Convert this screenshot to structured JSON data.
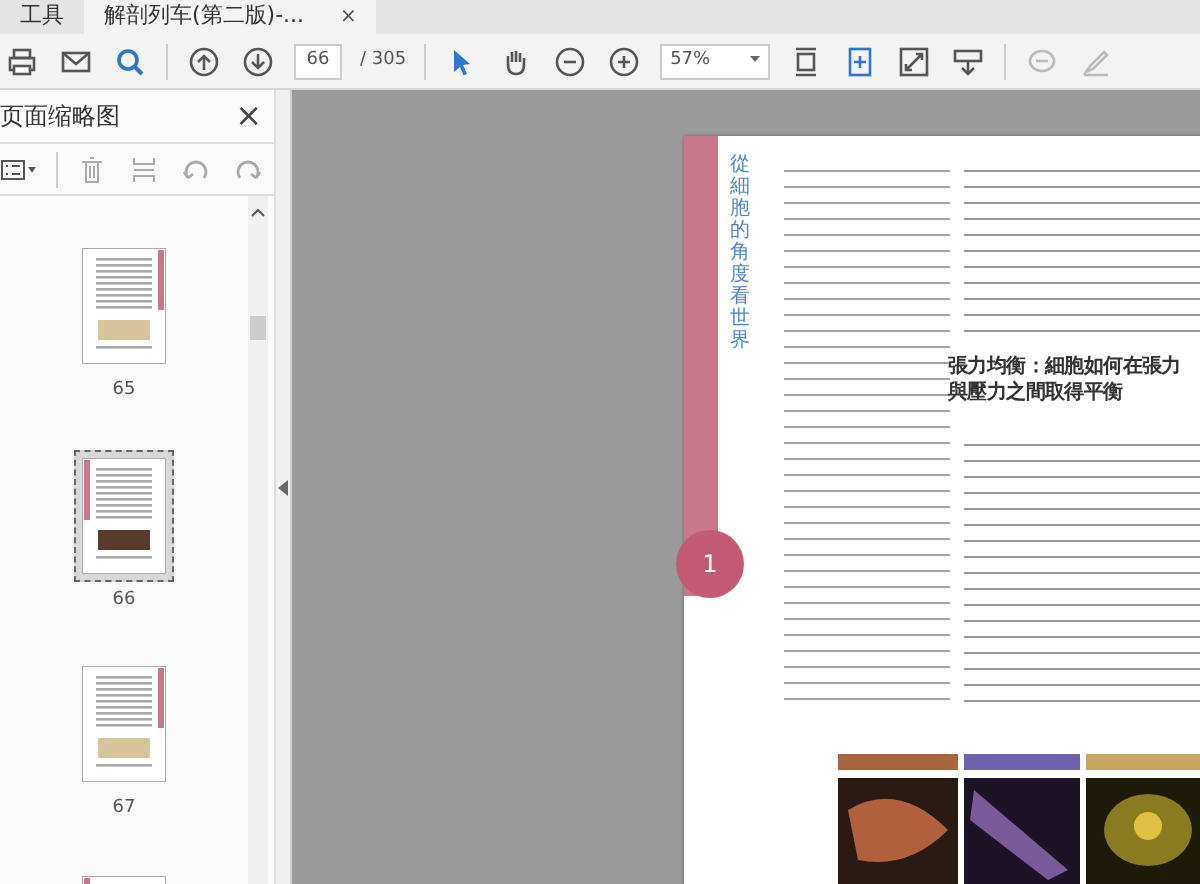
{
  "tabs": [
    {
      "label": "工具",
      "selected": false
    },
    {
      "label": "解剖列车(第二版)-...",
      "selected": true,
      "close": "×"
    }
  ],
  "toolbar": {
    "page_current": "66",
    "page_total": "/ 305",
    "zoom": "57%"
  },
  "panel": {
    "title": "页面缩略图",
    "close": "×",
    "thumbnails": [
      {
        "label": "65",
        "selected": false
      },
      {
        "label": "66",
        "selected": true
      },
      {
        "label": "67",
        "selected": false
      },
      {
        "selected": false
      }
    ]
  },
  "document": {
    "side_title": "從細胞的角度看世界",
    "chapter": "1",
    "heading_lines": [
      "張力均衡：細胞如何在張力",
      "與壓力之間取得平衡"
    ]
  }
}
